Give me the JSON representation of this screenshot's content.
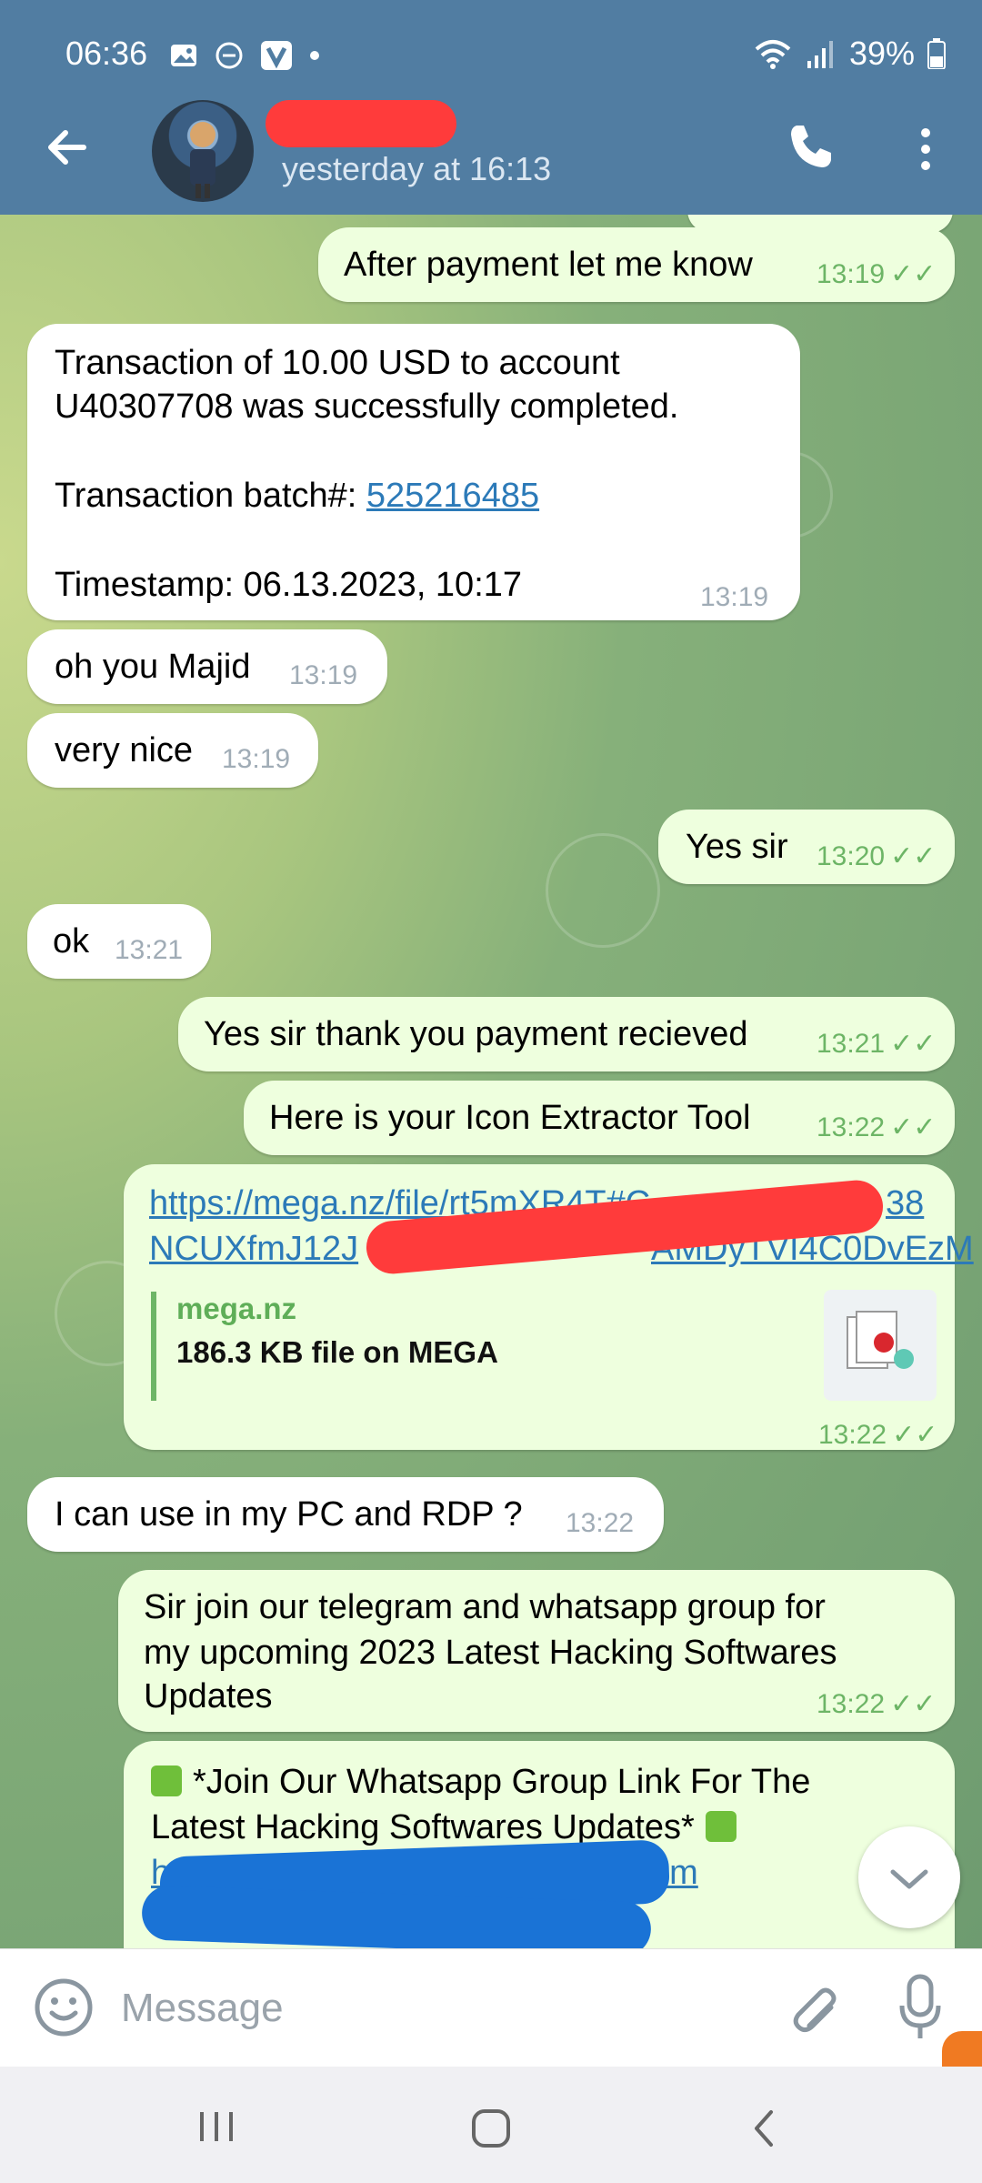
{
  "status": {
    "time": "06:36",
    "battery": "39%",
    "icons": [
      "image-icon",
      "dnd-icon",
      "app-v-icon",
      "dot-icon",
      "wifi-icon",
      "signal-icon",
      "battery-icon"
    ]
  },
  "header": {
    "last_seen": "yesterday at 16:13",
    "colors": {
      "bar": "#517da2"
    }
  },
  "messages": [
    {
      "dir": "out",
      "text": "After payment let me know",
      "time": "13:19"
    },
    {
      "dir": "in",
      "line1": "Transaction of 10.00 USD to account",
      "line2": "U40307708 was successfully completed.",
      "batch_label": "Transaction batch#: ",
      "batch_link": "525216485",
      "timestamp": "Timestamp: 06.13.2023, 10:17",
      "time": "13:19"
    },
    {
      "dir": "in",
      "text": "oh you Majid",
      "time": "13:19"
    },
    {
      "dir": "in",
      "text": "very nice",
      "time": "13:19"
    },
    {
      "dir": "out",
      "text": "Yes sir",
      "time": "13:20"
    },
    {
      "dir": "in",
      "text": "ok",
      "time": "13:21"
    },
    {
      "dir": "out",
      "text": "Yes sir thank you payment recieved",
      "time": "13:21"
    },
    {
      "dir": "out",
      "text": "Here is your Icon Extractor Tool",
      "time": "13:22"
    },
    {
      "dir": "out",
      "link_line1": "https://mega.nz/file/rt5mXR4T#C",
      "link_line1_end": "38",
      "link_line2": "NCUXfmJ12J",
      "link_line2_end": "AMDyTVI4C0DvEzM",
      "preview_site": "mega.nz",
      "preview_desc": "186.3 KB file on MEGA",
      "time": "13:22"
    },
    {
      "dir": "in",
      "text": "I can use in my PC and RDP ?",
      "time": "13:22"
    },
    {
      "dir": "out",
      "line1": "Sir join our telegram and whatsapp group for",
      "line2": "my upcoming 2023 Latest Hacking Softwares",
      "line3": "Updates",
      "time": "13:22"
    },
    {
      "dir": "out",
      "line1": "*Join Our Whatsapp Group Link For The",
      "line2": "Latest Hacking Softwares Updates*",
      "link_start": "http",
      "link_mid": "com"
    }
  ],
  "input": {
    "placeholder": "Message"
  }
}
